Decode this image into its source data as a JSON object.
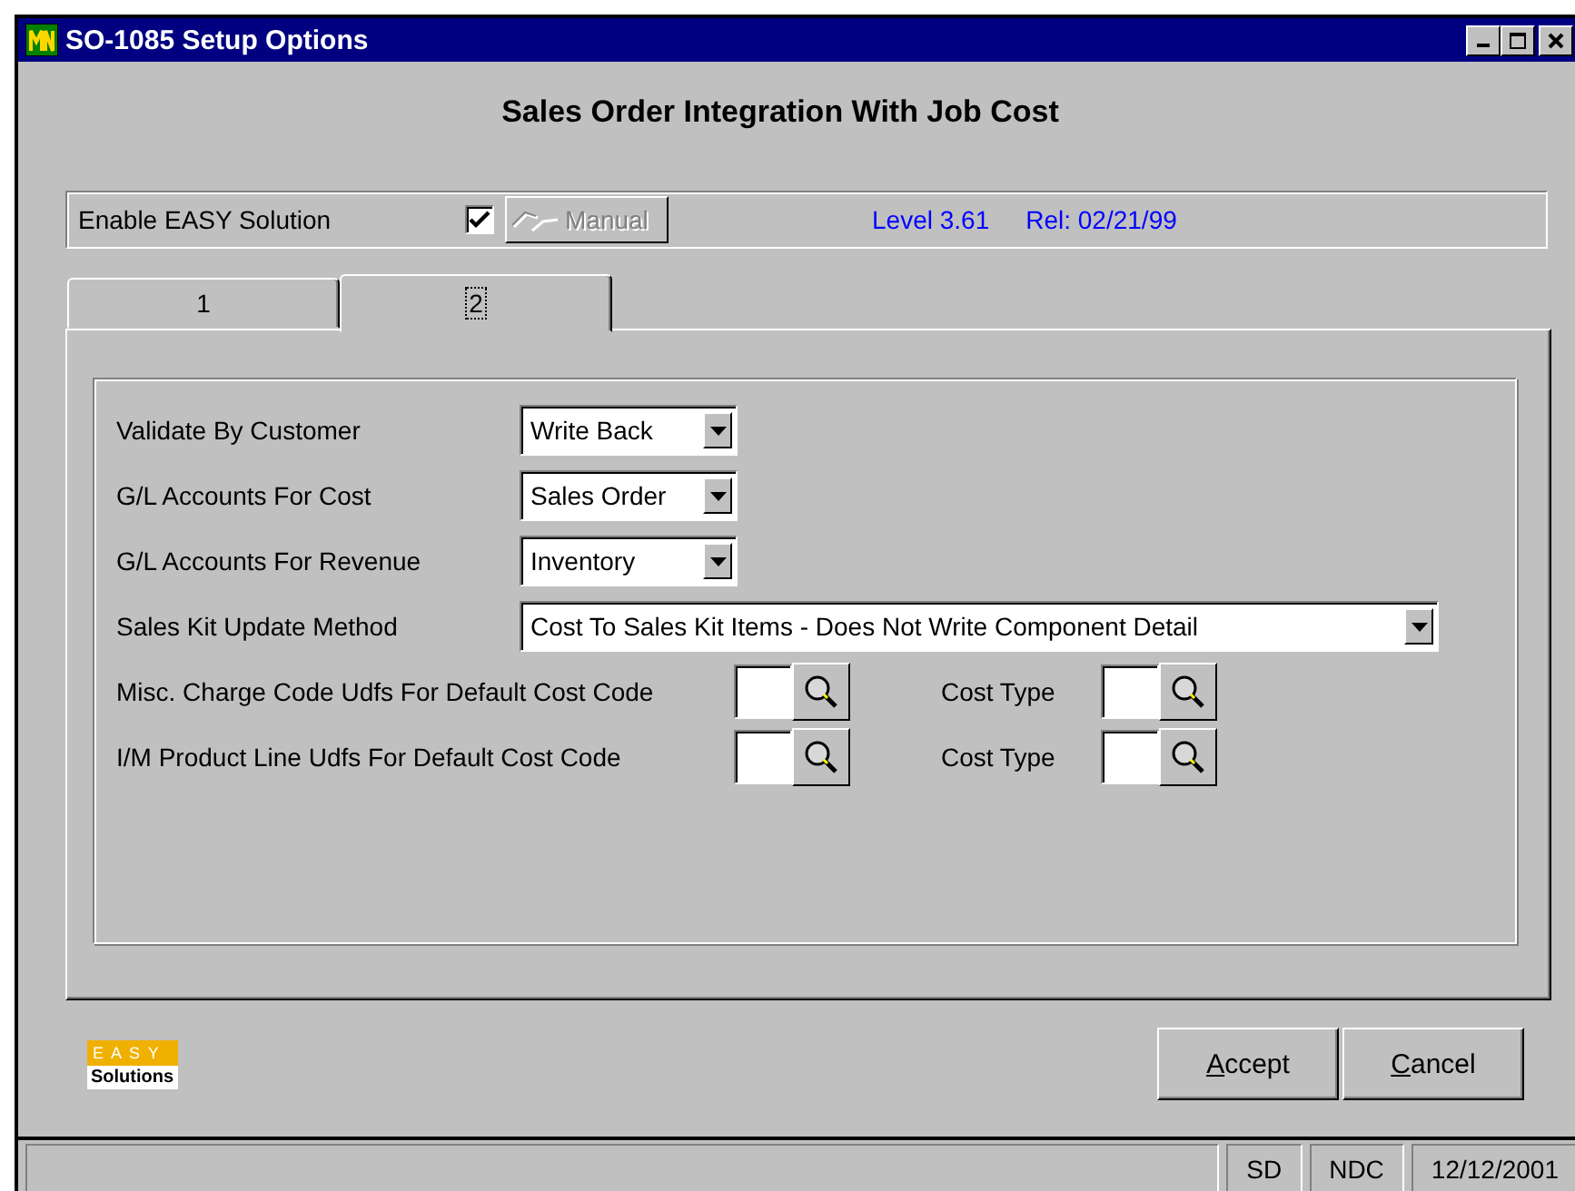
{
  "window": {
    "title": "SO-1085 Setup Options"
  },
  "heading": "Sales Order Integration With Job Cost",
  "easy_bar": {
    "label": "Enable EASY Solution",
    "checked": true,
    "manual_button": {
      "label": "Manual",
      "disabled": true
    },
    "level": "Level 3.61",
    "release": "Rel: 02/21/99"
  },
  "tabs": [
    {
      "label": "1",
      "selected": false
    },
    {
      "label": "2",
      "selected": true
    }
  ],
  "options": [
    {
      "kind": "dropdown",
      "label": "Validate By Customer",
      "value": "Write Back"
    },
    {
      "kind": "dropdown",
      "label": "G/L Accounts For Cost",
      "value": "Sales Order"
    },
    {
      "kind": "dropdown",
      "label": "G/L Accounts For Revenue",
      "value": "Inventory"
    },
    {
      "kind": "wide-dropdown",
      "label": "Sales Kit Update Method",
      "value": "Cost To Sales Kit Items - Does Not Write Component Detail"
    },
    {
      "kind": "lookup",
      "label": "Misc. Charge Code Udfs For Default Cost Code",
      "second_label": "Cost Type"
    },
    {
      "kind": "lookup",
      "label": "I/M Product Line Udfs For Default Cost Code",
      "second_label": "Cost Type"
    }
  ],
  "logo": {
    "top": "E A S Y",
    "bottom": "Solutions"
  },
  "buttons": [
    {
      "label": "Accept"
    },
    {
      "label": "Cancel"
    }
  ],
  "status_bar": [
    "SD",
    "NDC",
    "12/12/2001"
  ]
}
